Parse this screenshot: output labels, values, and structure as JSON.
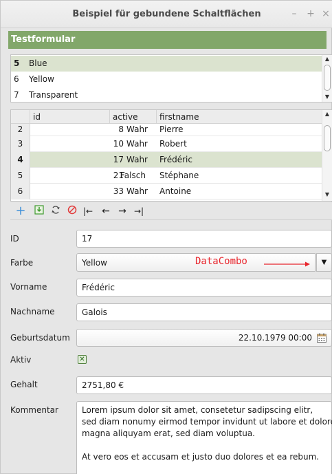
{
  "window": {
    "title": "Beispiel für gebundene Schaltflächen",
    "controls": {
      "minimize": "–",
      "maximize": "+",
      "close": "×"
    }
  },
  "form": {
    "header": "Testformular"
  },
  "list": {
    "rows": [
      {
        "num": "5",
        "value": "Blue",
        "selected": true
      },
      {
        "num": "6",
        "value": "Yellow",
        "selected": false
      },
      {
        "num": "7",
        "value": "Transparent",
        "selected": false
      }
    ]
  },
  "grid": {
    "columns": [
      "id",
      "active",
      "firstname"
    ],
    "rows": [
      {
        "rownum": "2",
        "id": "8",
        "active": "Wahr",
        "firstname": "Pierre",
        "selected": false
      },
      {
        "rownum": "3",
        "id": "10",
        "active": "Wahr",
        "firstname": "Robert",
        "selected": false
      },
      {
        "rownum": "4",
        "id": "17",
        "active": "Wahr",
        "firstname": "Frédéric",
        "selected": true
      },
      {
        "rownum": "5",
        "id": "21",
        "active": "Falsch",
        "firstname": "Stéphane",
        "selected": false
      },
      {
        "rownum": "6",
        "id": "33",
        "active": "Wahr",
        "firstname": "Antoine",
        "selected": false
      }
    ]
  },
  "navbar": {
    "icons": [
      "add-icon",
      "save-icon",
      "refresh-icon",
      "cancel-icon",
      "first-record-icon",
      "previous-record-icon",
      "next-record-icon",
      "last-record-icon"
    ],
    "colors": {
      "add": "#3d8fd8",
      "save": "#3f9b2f",
      "cancel": "#e23a3a"
    }
  },
  "fields": {
    "id": {
      "label": "ID",
      "value": "17"
    },
    "farbe": {
      "label": "Farbe",
      "value": "Yellow",
      "annotation": "DataCombo"
    },
    "vorname": {
      "label": "Vorname",
      "value": "Frédéric"
    },
    "nachname": {
      "label": "Nachname",
      "value": "Galois"
    },
    "geburtsdatum": {
      "label": "Geburtsdatum",
      "value": "22.10.1979 00:00"
    },
    "aktiv": {
      "label": "Aktiv",
      "checked": true
    },
    "gehalt": {
      "label": "Gehalt",
      "value": "2751,80 €"
    },
    "kommentar": {
      "label": "Kommentar",
      "lines": [
        "Lorem ipsum dolor sit amet, consetetur sadipscing elitr,",
        "sed diam nonumy eirmod tempor invidunt ut labore et dolore",
        "magna aliquyam erat, sed diam voluptua.",
        "",
        "At vero eos et accusam et justo duo dolores et ea rebum."
      ]
    }
  },
  "colors": {
    "accent": "#82a76a",
    "selection": "#dbe3cf",
    "annotation": "#e8262d"
  }
}
